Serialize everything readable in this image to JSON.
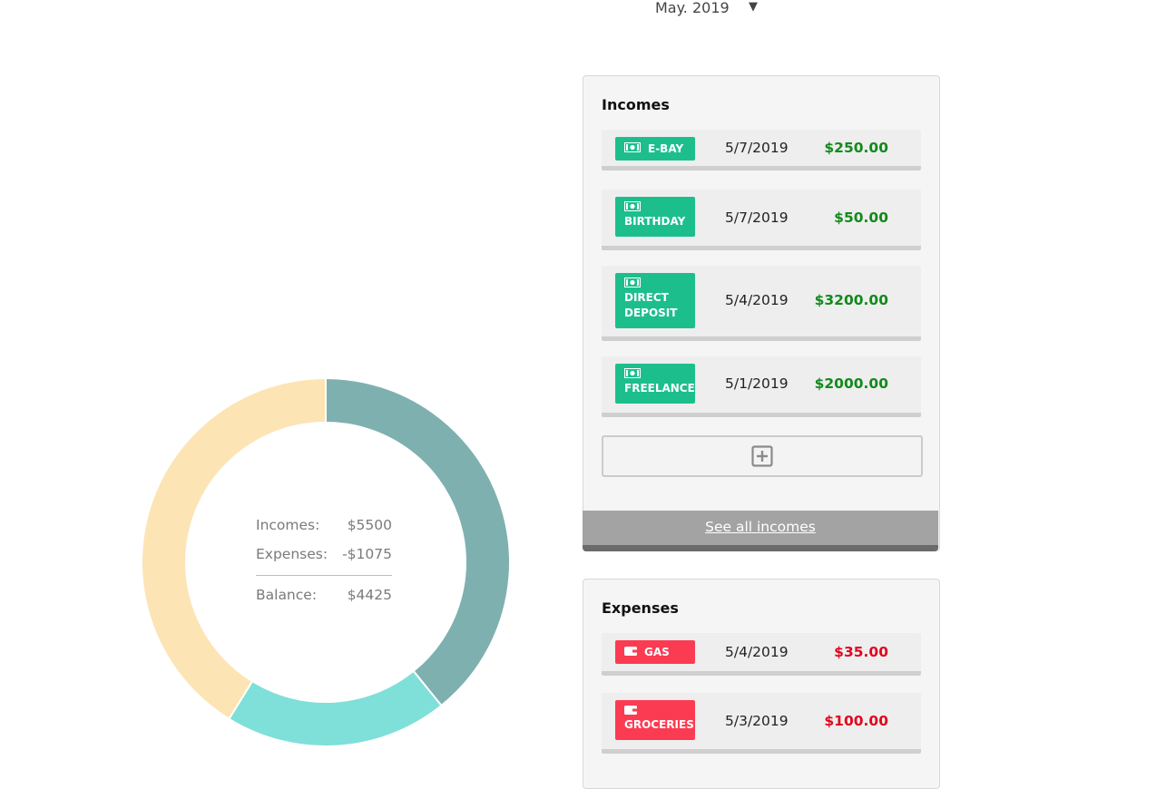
{
  "month_selector": {
    "label": "May. 2019",
    "caret": "▼"
  },
  "donut": {
    "segments": [
      {
        "name": "segment-teal-dark",
        "fraction": 0.392,
        "color": "#7fb0b0"
      },
      {
        "name": "segment-teal-light",
        "fraction": 0.196,
        "color": "#7fdfd9"
      },
      {
        "name": "segment-peach",
        "fraction": 0.412,
        "color": "#fde4b4"
      }
    ],
    "separator_color": "#ffffff"
  },
  "summary": {
    "incomes_label": "Incomes:",
    "incomes_value": "$5500",
    "expenses_label": "Expenses:",
    "expenses_value": "-$1075",
    "balance_label": "Balance:",
    "balance_value": "$4425"
  },
  "incomes": {
    "title": "Incomes",
    "items": [
      {
        "tag": "E-BAY",
        "date": "5/7/2019",
        "amount": "$250.00"
      },
      {
        "tag": "BIRTHDAY",
        "date": "5/7/2019",
        "amount": "$50.00"
      },
      {
        "tag_line1": "DIRECT",
        "tag_line2": "DEPOSIT",
        "date": "5/4/2019",
        "amount": "$3200.00"
      },
      {
        "tag": "FREELANCE",
        "date": "5/1/2019",
        "amount": "$2000.00"
      }
    ],
    "see_all": "See all incomes"
  },
  "expenses": {
    "title": "Expenses",
    "items": [
      {
        "tag": "GAS",
        "date": "5/4/2019",
        "amount": "$35.00"
      },
      {
        "tag": "GROCERIES",
        "date": "5/3/2019",
        "amount": "$100.00"
      }
    ]
  },
  "colors": {
    "income_tag": "#1cbf8c",
    "expense_tag": "#fb3b52",
    "income_amount": "#118a1b",
    "expense_amount": "#e0061f"
  },
  "icons": {
    "income_tag": "money-bill-icon",
    "expense_tag": "wallet-icon",
    "add": "plus-square-icon"
  }
}
